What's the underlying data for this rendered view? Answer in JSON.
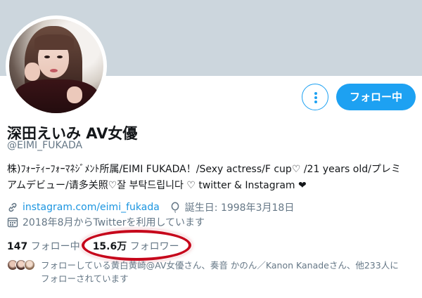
{
  "profile": {
    "display_name": "深田えいみ AV女優",
    "handle": "@EIMI_FUKADA",
    "bio_line1": "株)ﾌｫｰﾃｨｰﾌｫｰﾏﾈｼﾞﾒﾝﾄ所属/EIMI FUKADA！/Sexy actress/F cup♡ /21 years old/プレミ",
    "bio_line2": "アムデビュー/请多关照♡잘 부탁드립니다 ♡ twitter & Instagram ❤",
    "website": "instagram.com/eimi_fukada",
    "birthday": "誕生日: 1998年3月18日",
    "joined": "2018年8月からTwitterを利用しています"
  },
  "actions": {
    "more_icon": "more-vertical-icon",
    "follow_label": "フォロー中"
  },
  "stats": {
    "following_count": "147",
    "following_label": "フォロー中",
    "followers_count": "15.6万",
    "followers_label": "フォロワー"
  },
  "followers_you_know": {
    "line1": "フォローしている黄白黄崎@AV女優さん、奏音 かのん／Kanon Kanadeさん、他233人に",
    "line2": "フォローされています"
  },
  "colors": {
    "accent": "#1da1f2",
    "banner": "#ccd6dd",
    "annotation": "#c6061b"
  }
}
